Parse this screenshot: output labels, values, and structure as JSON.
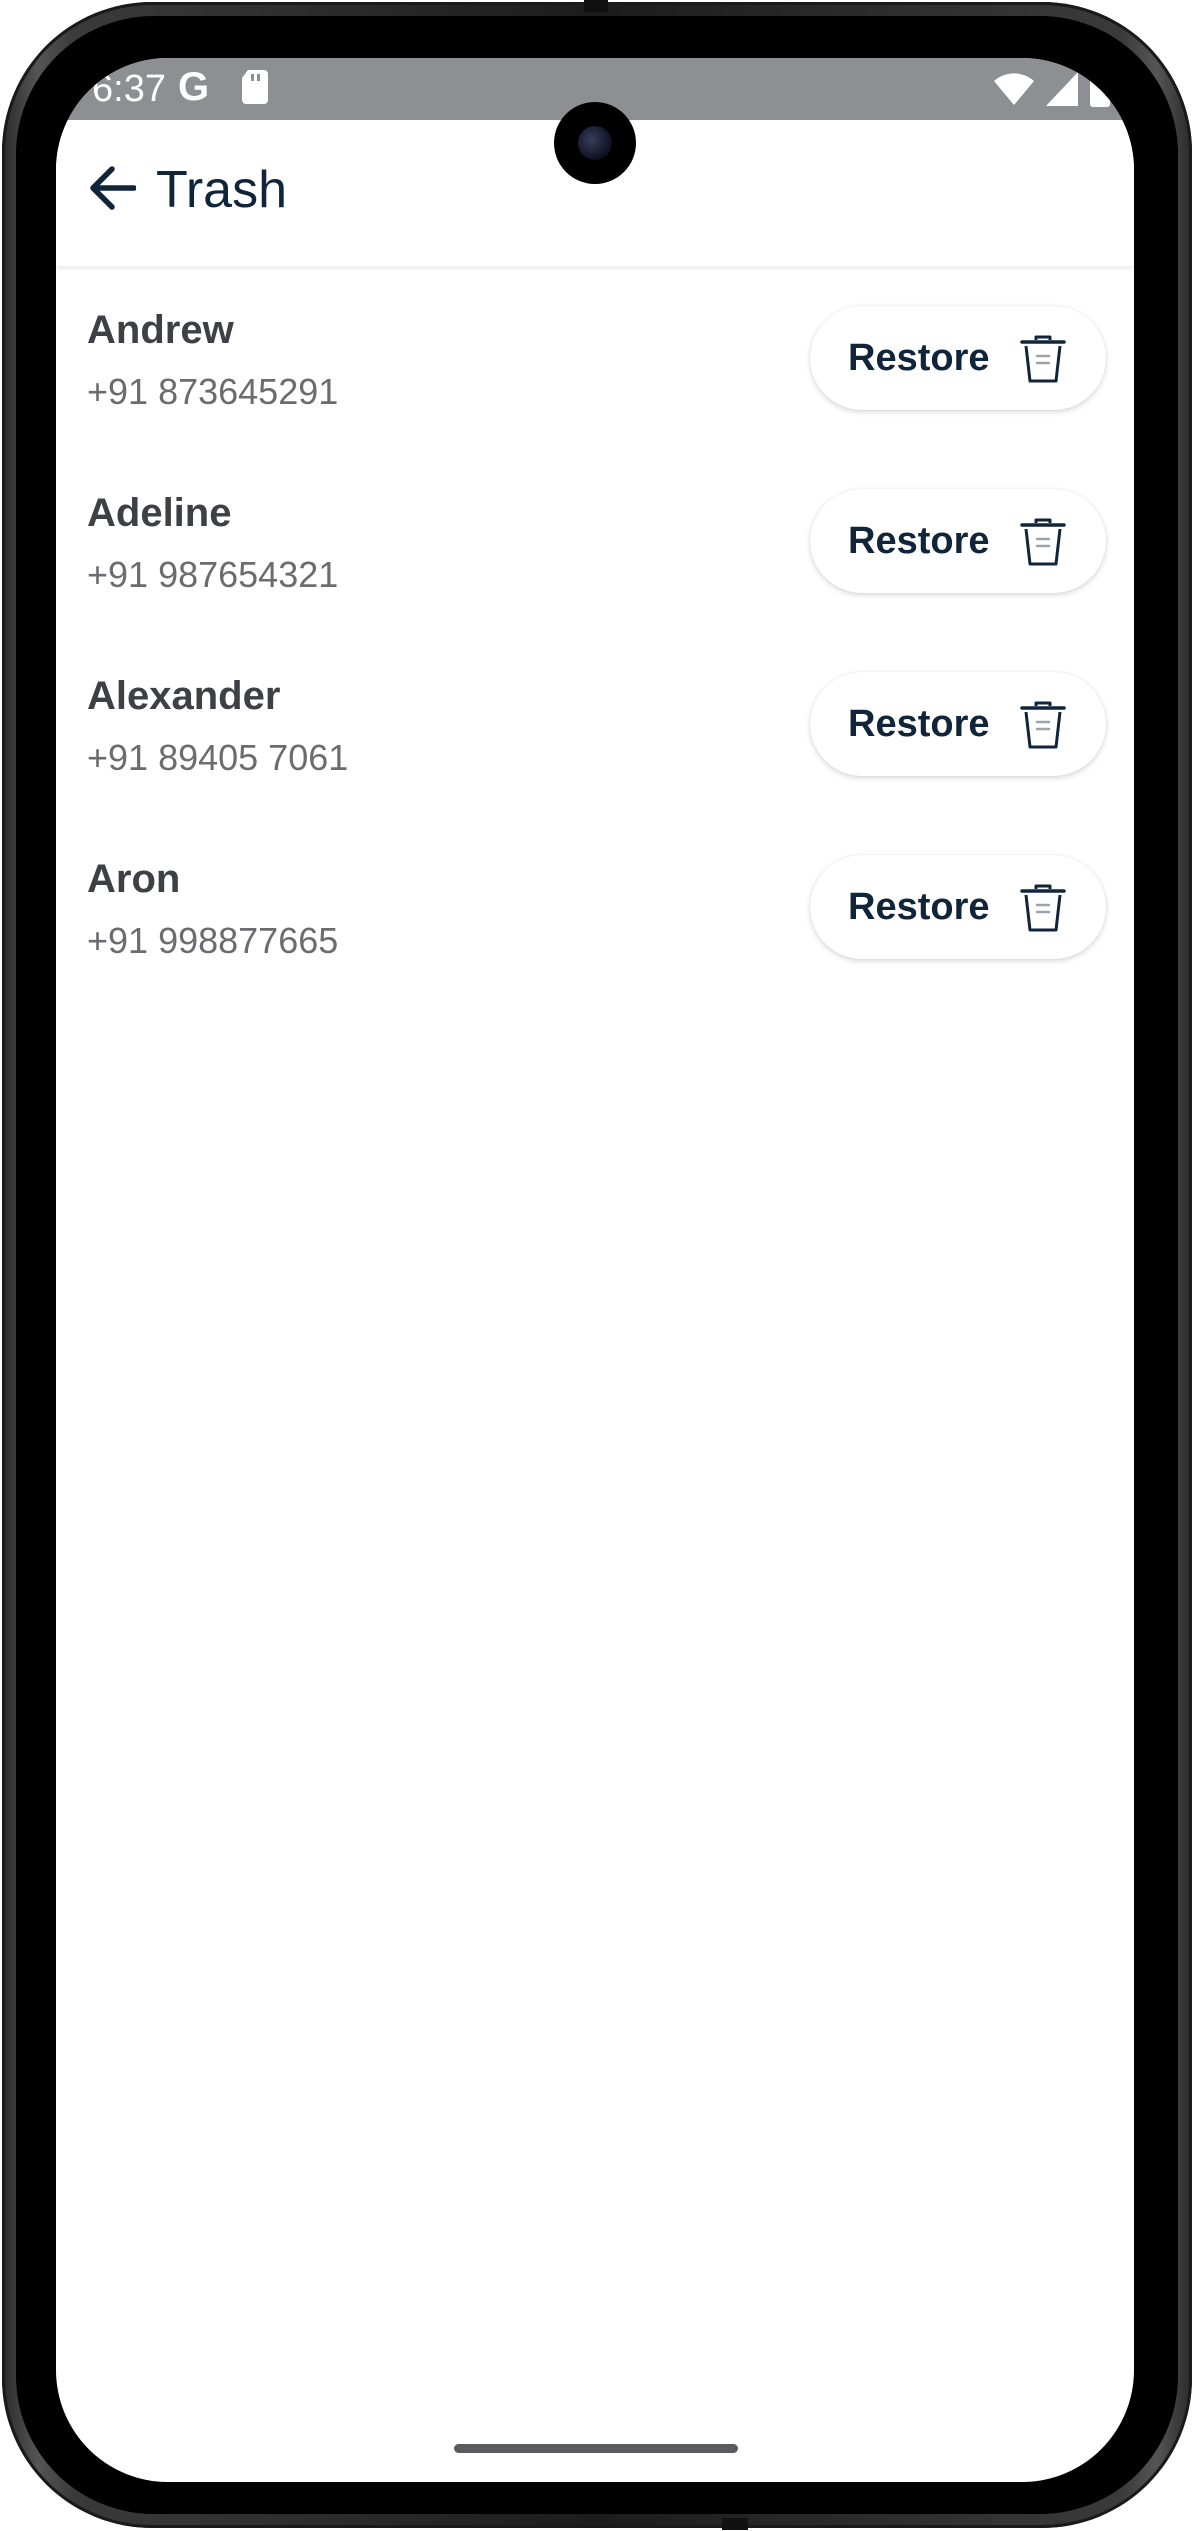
{
  "status_bar": {
    "time": "6:37",
    "g_icon": "google-g-icon",
    "sd_icon": "sd-card-icon",
    "wifi_icon": "wifi-icon",
    "signal_icon": "signal-icon",
    "battery_icon": "battery-icon"
  },
  "app_bar": {
    "back_icon": "arrow-left-icon",
    "title": "Trash"
  },
  "contacts": [
    {
      "name": "Andrew",
      "phone": "+91 873645291",
      "action_label": "Restore",
      "action_icon": "trash-can-icon"
    },
    {
      "name": "Adeline",
      "phone": "+91 987654321",
      "action_label": "Restore",
      "action_icon": "trash-can-icon"
    },
    {
      "name": "Alexander",
      "phone": "+91 89405 7061",
      "action_label": "Restore",
      "action_icon": "trash-can-icon"
    },
    {
      "name": "Aron",
      "phone": "+91 998877665",
      "action_label": "Restore",
      "action_icon": "trash-can-icon"
    }
  ],
  "colors": {
    "primary_text": "#10243a",
    "name_text": "#3f4045",
    "secondary_text": "#6c6c70",
    "status_bar_bg": "#8e8f92"
  }
}
